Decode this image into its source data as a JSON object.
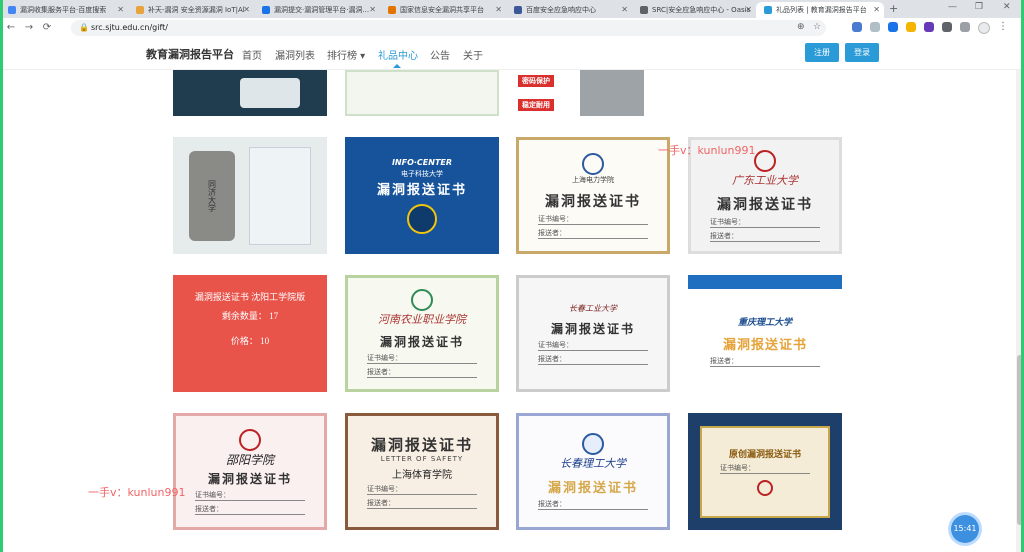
{
  "browser": {
    "tabs": [
      {
        "title": "漏洞收集服务平台·百度搜索",
        "color": "#4285f4",
        "active": false
      },
      {
        "title": "补天-漏洞 安全资源漏洞 IoT|Al",
        "color": "#e8a33d",
        "active": false
      },
      {
        "title": "漏洞提交·漏洞管理平台·漏洞...",
        "color": "#1a73e8",
        "active": false
      },
      {
        "title": "国家信息安全漏洞共享平台",
        "color": "#e37400",
        "active": false
      },
      {
        "title": "百度安全应急响应中心",
        "color": "#3b5998",
        "active": false
      },
      {
        "title": "SRC|安全应急响应中心 - Oasis",
        "color": "#5f6368",
        "active": false
      },
      {
        "title": "礼品列表 | 教育漏洞报告平台",
        "color": "#2a9bd7",
        "active": true
      }
    ],
    "url": "src.sjtu.edu.cn/gift/",
    "toolbar_icons": [
      "zoom-icon",
      "share-icon",
      "bookmark-star-icon",
      "extension-icon",
      "extensions-puzzle-icon",
      "profile-icon",
      "menu-icon"
    ]
  },
  "site": {
    "logo": "教育漏洞报告平台",
    "nav": [
      "首页",
      "漏洞列表",
      "排行榜 ▾",
      "礼品中心",
      "公告",
      "关于"
    ],
    "active_nav": "礼品中心",
    "register": "注册",
    "login": "登录",
    "accent": "#2a9bd7"
  },
  "gifts": {
    "row0": [
      "",
      "",
      "密码保护",
      "稳定耐用"
    ],
    "cards": [
      {
        "type": "thermos",
        "school": "同济大学"
      },
      {
        "type": "cert-blue",
        "brand": "INFO·CENTER",
        "school": "电子科技大学",
        "title": "漏洞报送证书"
      },
      {
        "type": "cert",
        "school": "上海电力学院",
        "title": "漏洞报送证书",
        "fields": [
          "证书编号：",
          "报送者："
        ]
      },
      {
        "type": "cert",
        "school": "广东工业大学",
        "title": "漏洞报送证书",
        "fields": [
          "证书编号：",
          "报送者："
        ]
      },
      {
        "type": "red",
        "lines": [
          "漏洞报送证书 沈阳工学院版",
          "剩余数量： 17",
          "价格： 10"
        ]
      },
      {
        "type": "cert",
        "school": "河南农业职业学院",
        "title": "漏洞报送证书",
        "fields": [
          "证书编号：",
          "报送者："
        ]
      },
      {
        "type": "cert",
        "school": "长春工业大学",
        "title": "漏洞报送证书",
        "fields": [
          "证书编号：",
          "报送者："
        ]
      },
      {
        "type": "cert-blue2",
        "school": "重庆理工大学",
        "title": "漏洞报送证书",
        "fields": [
          "报送者："
        ]
      },
      {
        "type": "cert-pink",
        "school": "邵阳学院",
        "title": "漏洞报送证书",
        "fields": [
          "证书编号：",
          "报送者："
        ]
      },
      {
        "type": "cert-brown",
        "title": "漏洞报送证书",
        "subtitle": "LETTER OF SAFETY",
        "school": "上海体育学院",
        "fields": [
          "证书编号：",
          "报送者："
        ]
      },
      {
        "type": "cert-gold",
        "school": "长春理工大学",
        "title": "漏洞报送证书",
        "fields": [
          "报送者："
        ]
      },
      {
        "type": "cert-navy",
        "title": "原创漏洞报送证书",
        "fields": [
          "证书编号："
        ]
      }
    ]
  },
  "watermark": "一手v：kunlun991",
  "clock": "15:41"
}
